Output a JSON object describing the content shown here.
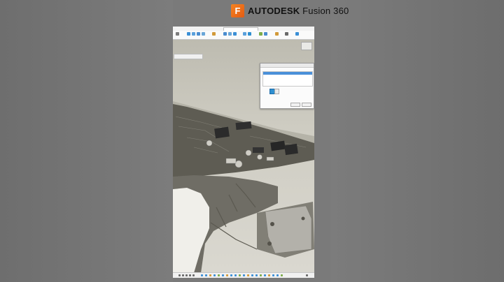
{
  "brand": {
    "logo_letter": "F",
    "name_bold": "AUTODESK",
    "name_regular": "Fusion 360",
    "logo_color": "#F58220"
  },
  "app": {
    "document_tab": "",
    "browser_label": "",
    "viewcube_label": "",
    "dialog": {
      "title": "",
      "ok_label": "",
      "cancel_label": ""
    }
  },
  "colors": {
    "accent_blue": "#2F8FD0",
    "viewport_bg": "#D8D6CE",
    "model_gray": "#8A877C"
  }
}
